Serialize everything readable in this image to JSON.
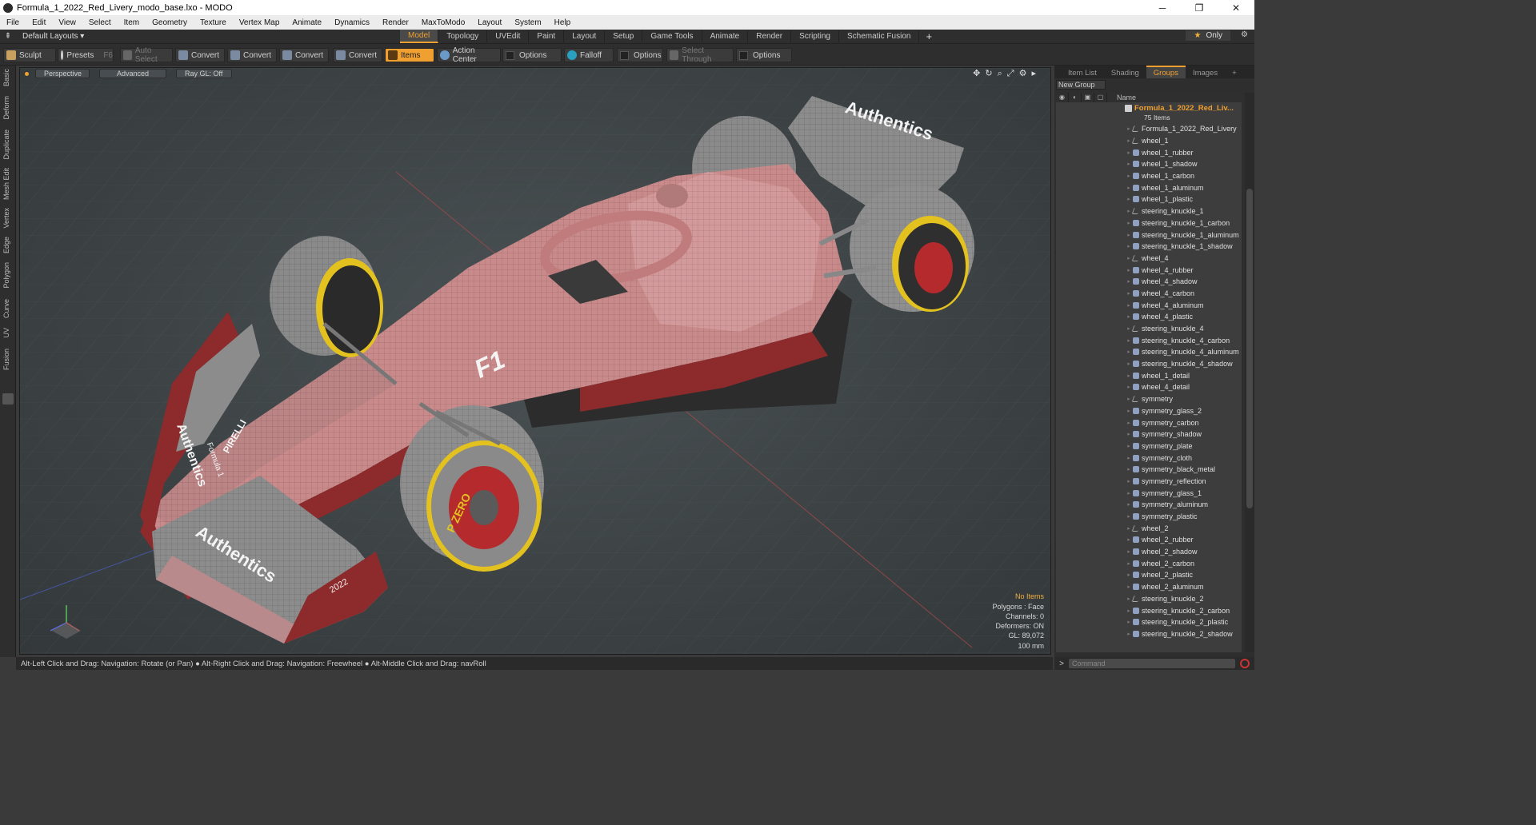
{
  "window": {
    "title": "Formula_1_2022_Red_Livery_modo_base.lxo - MODO",
    "min": "─",
    "restore": "❐",
    "close": "✕"
  },
  "menu": [
    "File",
    "Edit",
    "View",
    "Select",
    "Item",
    "Geometry",
    "Texture",
    "Vertex Map",
    "Animate",
    "Dynamics",
    "Render",
    "MaxToModo",
    "Layout",
    "System",
    "Help"
  ],
  "layout": {
    "selector": "Default Layouts ▾",
    "tabs": [
      "Model",
      "Topology",
      "UVEdit",
      "Paint",
      "Layout",
      "Setup",
      "Game Tools",
      "Animate",
      "Render",
      "Scripting",
      "Schematic Fusion"
    ],
    "active_tab": "Model",
    "only_label": "Only",
    "only_star": "★"
  },
  "toolbar": {
    "sculpt": "Sculpt",
    "presets": "Presets",
    "presets_key": "F6",
    "auto_select": "Auto Select",
    "convert1": "Convert",
    "convert2": "Convert",
    "convert3": "Convert",
    "convert4": "Convert",
    "items": "Items",
    "action_center": "Action Center",
    "options1": "Options",
    "falloff": "Falloff",
    "options2": "Options",
    "select_through": "Select Through",
    "options3": "Options"
  },
  "left_tabs": [
    "Basic",
    "Deform",
    "Duplicate",
    "Mesh Edit",
    "Vertex",
    "Edge",
    "Polygon",
    "Curve",
    "UV",
    "Fusion"
  ],
  "viewport": {
    "perspective": "Perspective",
    "advanced": "Advanced",
    "raygl": "Ray GL: Off",
    "stats": {
      "no_items": "No Items",
      "polygons": "Polygons : Face",
      "channels": "Channels: 0",
      "deformers": "Deformers: ON",
      "gl": "GL: 89,072",
      "scale": "100 mm"
    },
    "decals": {
      "nose_logo": "F1",
      "nose_text": "Authentics",
      "wing_text": "Authentics",
      "pirelli": "PIRELLI",
      "formula1": "Formula 1",
      "pzero": "P ZERO",
      "year": "2022"
    },
    "colors": {
      "body_red": "#8d2a2c",
      "body_pink": "#c98a8b",
      "tyre_grey": "#8c8c8c",
      "tyre_yellow": "#e3c21f"
    }
  },
  "status": "Alt-Left Click and Drag: Navigation: Rotate (or Pan) ● Alt-Right Click and Drag: Navigation: Freewheel ● Alt-Middle Click and Drag: navRoll",
  "panel": {
    "tabs": [
      "Item List",
      "Shading",
      "Groups",
      "Images"
    ],
    "active_tab": "Groups",
    "new_group": "New Group",
    "name_header": "Name",
    "root_label": "Formula_1_2022_Red_Liv...",
    "root_count": "75 Items",
    "items": [
      {
        "name": "Formula_1_2022_Red_Livery",
        "kind": "locator"
      },
      {
        "name": "wheel_1",
        "kind": "locator"
      },
      {
        "name": "wheel_1_rubber",
        "kind": "mesh"
      },
      {
        "name": "wheel_1_shadow",
        "kind": "mesh"
      },
      {
        "name": "wheel_1_carbon",
        "kind": "mesh"
      },
      {
        "name": "wheel_1_aluminum",
        "kind": "mesh"
      },
      {
        "name": "wheel_1_plastic",
        "kind": "mesh"
      },
      {
        "name": "steering_knuckle_1",
        "kind": "locator"
      },
      {
        "name": "steering_knuckle_1_carbon",
        "kind": "mesh"
      },
      {
        "name": "steering_knuckle_1_aluminum",
        "kind": "mesh"
      },
      {
        "name": "steering_knuckle_1_shadow",
        "kind": "mesh"
      },
      {
        "name": "wheel_4",
        "kind": "locator"
      },
      {
        "name": "wheel_4_rubber",
        "kind": "mesh"
      },
      {
        "name": "wheel_4_shadow",
        "kind": "mesh"
      },
      {
        "name": "wheel_4_carbon",
        "kind": "mesh"
      },
      {
        "name": "wheel_4_aluminum",
        "kind": "mesh"
      },
      {
        "name": "wheel_4_plastic",
        "kind": "mesh"
      },
      {
        "name": "steering_knuckle_4",
        "kind": "locator"
      },
      {
        "name": "steering_knuckle_4_carbon",
        "kind": "mesh"
      },
      {
        "name": "steering_knuckle_4_aluminum",
        "kind": "mesh"
      },
      {
        "name": "steering_knuckle_4_shadow",
        "kind": "mesh"
      },
      {
        "name": "wheel_1_detail",
        "kind": "mesh"
      },
      {
        "name": "wheel_4_detail",
        "kind": "mesh"
      },
      {
        "name": "symmetry",
        "kind": "locator"
      },
      {
        "name": "symmetry_glass_2",
        "kind": "mesh"
      },
      {
        "name": "symmetry_carbon",
        "kind": "mesh"
      },
      {
        "name": "symmetry_shadow",
        "kind": "mesh"
      },
      {
        "name": "symmetry_plate",
        "kind": "mesh"
      },
      {
        "name": "symmetry_cloth",
        "kind": "mesh"
      },
      {
        "name": "symmetry_black_metal",
        "kind": "mesh"
      },
      {
        "name": "symmetry_reflection",
        "kind": "mesh"
      },
      {
        "name": "symmetry_glass_1",
        "kind": "mesh"
      },
      {
        "name": "symmetry_aluminum",
        "kind": "mesh"
      },
      {
        "name": "symmetry_plastic",
        "kind": "mesh"
      },
      {
        "name": "wheel_2",
        "kind": "locator"
      },
      {
        "name": "wheel_2_rubber",
        "kind": "mesh"
      },
      {
        "name": "wheel_2_shadow",
        "kind": "mesh"
      },
      {
        "name": "wheel_2_carbon",
        "kind": "mesh"
      },
      {
        "name": "wheel_2_plastic",
        "kind": "mesh"
      },
      {
        "name": "wheel_2_aluminum",
        "kind": "mesh"
      },
      {
        "name": "steering_knuckle_2",
        "kind": "locator"
      },
      {
        "name": "steering_knuckle_2_carbon",
        "kind": "mesh"
      },
      {
        "name": "steering_knuckle_2_plastic",
        "kind": "mesh"
      },
      {
        "name": "steering_knuckle_2_shadow",
        "kind": "mesh"
      }
    ]
  },
  "command": {
    "prompt": ">",
    "placeholder": "Command"
  }
}
